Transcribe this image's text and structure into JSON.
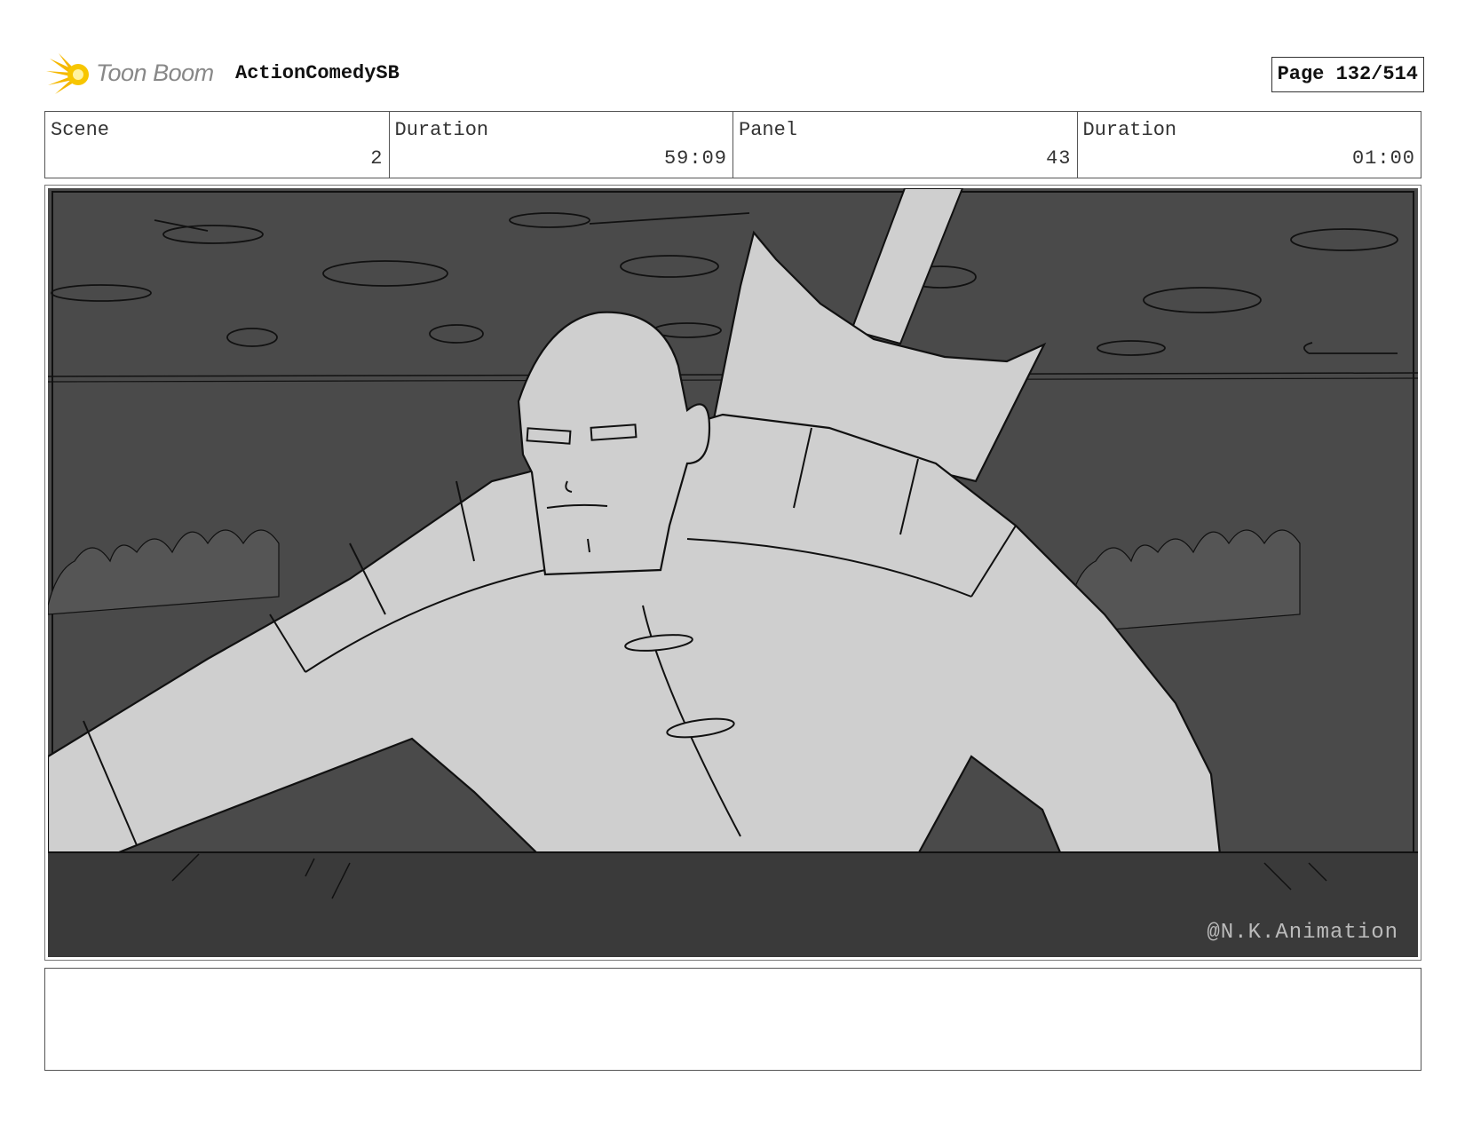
{
  "header": {
    "logo_text": "Toon Boom",
    "project_title": "ActionComedySB",
    "page_label": "Page 132/514"
  },
  "info": {
    "scene_label": "Scene",
    "scene_value": "2",
    "duration_label": "Duration",
    "duration_value": "59:09",
    "panel_label": "Panel",
    "panel_value": "43",
    "panel_duration_label": "Duration",
    "panel_duration_value": "01:00"
  },
  "panel": {
    "watermark": "@N.K.Animation",
    "colors": {
      "background": "#4a4a4a",
      "figure": "#cfcfcf",
      "floor": "#3a3a3a",
      "line": "#111111"
    }
  },
  "notes": {
    "text": ""
  }
}
